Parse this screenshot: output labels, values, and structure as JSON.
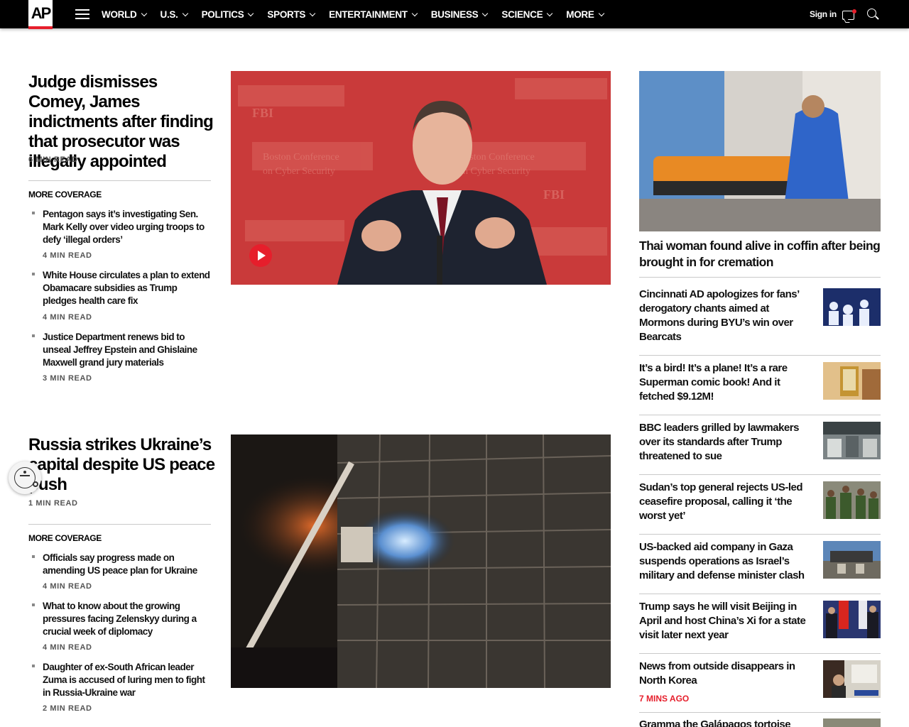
{
  "header": {
    "logo": "AP",
    "nav": [
      "WORLD",
      "U.S.",
      "POLITICS",
      "SPORTS",
      "ENTERTAINMENT",
      "BUSINESS",
      "SCIENCE",
      "MORE"
    ],
    "sign_in": "Sign in"
  },
  "lead1": {
    "headline": "Judge dismisses Comey, James indictments after finding that prosecutor was illegally appointed",
    "read_time": "6 MIN READ",
    "more_label": "MORE COVERAGE",
    "items": [
      {
        "headline": "Pentagon says it’s investigating Sen. Mark Kelly over video urging troops to defy ‘illegal orders’",
        "read_time": "4 MIN READ"
      },
      {
        "headline": "White House circulates a plan to extend Obamacare subsidies as Trump pledges health care fix",
        "read_time": "4 MIN READ"
      },
      {
        "headline": "Justice Department renews bid to unseal Jeffrey Epstein and Ghislaine Maxwell grand jury materials",
        "read_time": "3 MIN READ"
      }
    ]
  },
  "lead2": {
    "headline": "Russia strikes Ukraine’s capital despite US peace push",
    "read_time": "1 MIN READ",
    "more_label": "MORE COVERAGE",
    "items": [
      {
        "headline": "Officials say progress made on amending US peace plan for Ukraine",
        "read_time": "4 MIN READ"
      },
      {
        "headline": "What to know about the growing pressures facing Zelenskyy during a crucial week of diplomacy",
        "read_time": "4 MIN READ"
      },
      {
        "headline": "Daughter of ex-South African leader Zuma is accused of luring men to fight in Russia-Ukraine war",
        "read_time": "2 MIN READ"
      }
    ]
  },
  "sidebar": {
    "feature_headline": "Thai woman found alive in coffin after being brought in for cremation",
    "items": [
      {
        "headline": "Cincinnati AD apologizes for fans’ derogatory chants aimed at Mormons during BYU’s win over Bearcats"
      },
      {
        "headline": "It’s a bird! It’s a plane! It’s a rare Superman comic book! And it fetched $9.12M!"
      },
      {
        "headline": "BBC leaders grilled by lawmakers over its standards after Trump threatened to sue"
      },
      {
        "headline": "Sudan’s top general rejects US-led ceasefire proposal, calling it ‘the worst yet’"
      },
      {
        "headline": "US-backed aid company in Gaza suspends operations as Israel’s military and defense minister clash"
      },
      {
        "headline": "Trump says he will visit Beijing in April and host China’s Xi for a state visit later next year"
      },
      {
        "headline": "News from outside disappears in North Korea",
        "time": "7 MINS AGO"
      },
      {
        "headline": "Gramma the Galápagos tortoise"
      }
    ]
  },
  "colors": {
    "accent": "#e61e2b",
    "nav_bg": "#000000"
  }
}
